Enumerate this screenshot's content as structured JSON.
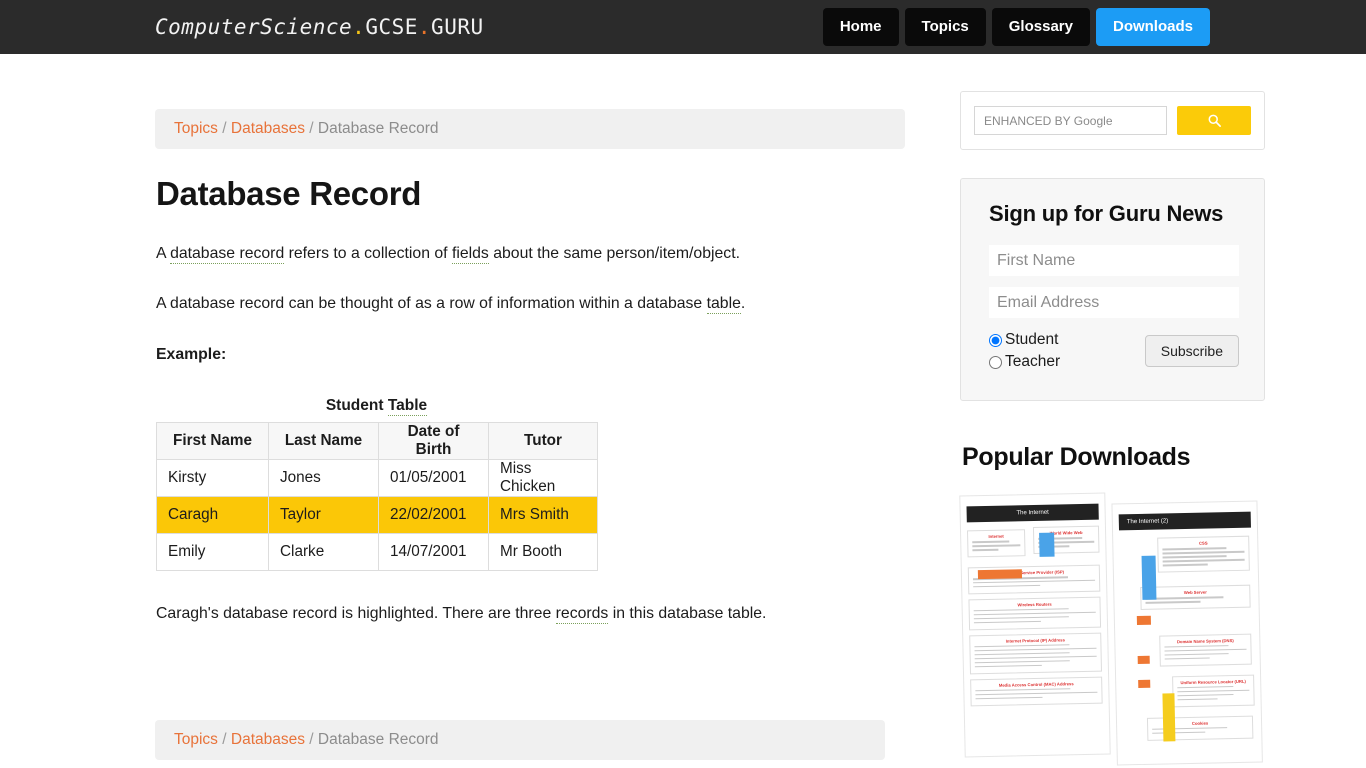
{
  "site": {
    "brand_part1": "ComputerScience",
    "brand_dot1": ".",
    "brand_part2": "GCSE",
    "brand_dot2": ".",
    "brand_part3": "GURU",
    "accent_blue": "#1c9cf5",
    "accent_yellow": "#fbcb09",
    "accent_orange": "#e8733a",
    "highlight_yellow": "#fbc707",
    "glossary_underline": "#7ba05b"
  },
  "nav": {
    "items": [
      {
        "label": "Home",
        "active": false
      },
      {
        "label": "Topics",
        "active": false
      },
      {
        "label": "Glossary",
        "active": false
      },
      {
        "label": "Downloads",
        "active": true
      }
    ]
  },
  "breadcrumb": {
    "topics": "Topics",
    "databases": "Databases",
    "current": "Database Record",
    "sep": "/"
  },
  "article": {
    "title": "Database Record",
    "p1_a": "A ",
    "p1_term1": "database record",
    "p1_b": " refers to a collection of ",
    "p1_term2": "fields",
    "p1_c": " about the same person/item/object.",
    "p2_a": "A database record can be thought of as a row of information within a database ",
    "p2_term": "table",
    "p2_b": ".",
    "example_label": "Example:",
    "closing_a": "Caragh's database record is highlighted.  There are three ",
    "closing_term": "records",
    "closing_b": " in this database table."
  },
  "table": {
    "caption_plain": "Student ",
    "caption_term": "Table",
    "headers": [
      "First Name",
      "Last Name",
      "Date of Birth",
      "Tutor"
    ],
    "rows": [
      {
        "cells": [
          "Kirsty",
          "Jones",
          "01/05/2001",
          "Miss Chicken"
        ],
        "highlight": false
      },
      {
        "cells": [
          "Caragh",
          "Taylor",
          "22/02/2001",
          "Mrs Smith"
        ],
        "highlight": true
      },
      {
        "cells": [
          "Emily",
          "Clarke",
          "14/07/2001",
          "Mr Booth"
        ],
        "highlight": false
      }
    ]
  },
  "search": {
    "placeholder": "ENHANCED BY Google",
    "value": "",
    "button_icon": "search-icon"
  },
  "newsletter": {
    "title": "Sign up for Guru News",
    "first_name_placeholder": "First Name",
    "first_name_value": "",
    "email_placeholder": "Email Address",
    "email_value": "",
    "option_student": "Student",
    "option_teacher": "Teacher",
    "selected_option": "Student",
    "subscribe_label": "Subscribe"
  },
  "downloads": {
    "title": "Popular Downloads",
    "thumbnails": [
      {
        "title": "The Internet"
      },
      {
        "title": "The Internet (2)"
      }
    ]
  }
}
